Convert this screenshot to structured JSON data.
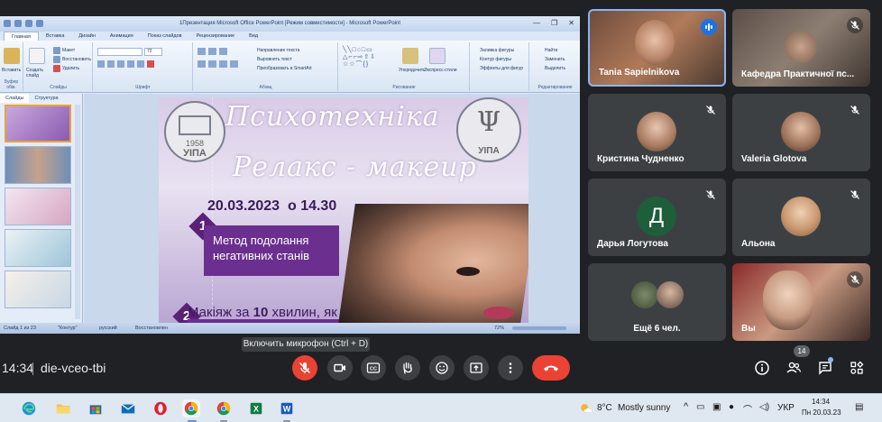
{
  "ppt": {
    "window_title": "1Презентация Microsoft Office PowerPoint [Режим совместимости] - Microsoft PowerPoint",
    "tabs": [
      "Главная",
      "Вставка",
      "Дизайн",
      "Анимация",
      "Показ слайдов",
      "Рецензирование",
      "Вид"
    ],
    "ribbon": {
      "paste": "Вставить",
      "clipboard": "Буфер обм.",
      "create_slide": "Создать слайд",
      "layout": "Макет",
      "reset": "Восстановить",
      "delete": "Удалить",
      "slides_group": "Слайды",
      "font_size": "72",
      "font_group": "Шрифт",
      "paragraph_group": "Абзац",
      "text_direction": "Направление текста",
      "align_text": "Выровнять текст",
      "smartart": "Преобразовать в SmartArt",
      "arrange": "Упорядочить",
      "quick_styles": "Экспресс-стили",
      "drawing_group": "Рисование",
      "shape_fill": "Заливка фигуры",
      "shape_outline": "Контур фигуры",
      "shape_effects": "Эффекты для фигур",
      "find": "Найти",
      "replace": "Заменить",
      "select": "Выделить",
      "editing_group": "Редактирование"
    },
    "panel_tabs": [
      "Слайды",
      "Структура"
    ],
    "status": {
      "slide": "Слайд 1 из 23",
      "theme": "\"Контур\"",
      "language": "русский",
      "restored": "Восстановлен",
      "zoom": "72%"
    }
  },
  "slide": {
    "title1": "Психотехніка",
    "title2": "Релакс - макеup",
    "date": "20.03.2023",
    "time": "о 14.30",
    "items": [
      {
        "num": "1",
        "text": "Метод подолання негативних станів"
      },
      {
        "num": "2",
        "text_pre": "Макіяж за ",
        "text_bold": "10",
        "text_post": " хвилин, як покращення"
      }
    ],
    "emblem_left_year": "1958",
    "emblem_left_abbr": "УІПА",
    "emblem_right_abbr": "УІПА"
  },
  "tooltip": "Включить микрофон (Ctrl + D)",
  "participants": [
    {
      "name": "Tania Sapielnikova",
      "initial": "",
      "talking": true
    },
    {
      "name": "Кафедра Практичної пс...",
      "initial": ""
    },
    {
      "name": "Кристина Чудненко",
      "initial": ""
    },
    {
      "name": "Valeria Glotova",
      "initial": ""
    },
    {
      "name": "Дарья Логутова",
      "initial": "Д"
    },
    {
      "name": "Альона",
      "initial": ""
    },
    {
      "name": "Ещё 6 чел.",
      "initial": ""
    },
    {
      "name": "Вы",
      "initial": ""
    }
  ],
  "bottom_bar": {
    "time": "14:34",
    "meeting_code": "die-vceo-tbi",
    "participants_count": "14"
  },
  "taskbar": {
    "weather_temp": "8°C",
    "weather_text": "Mostly sunny",
    "language": "УКР",
    "time": "14:34",
    "date": "Пн 20.03.23"
  },
  "colors": {
    "meet_bg": "#202124",
    "tile_bg": "#3c4043",
    "end_call": "#ea4335",
    "accent_blue": "#8ab4f8",
    "slide_purple": "#6b2f8f"
  }
}
